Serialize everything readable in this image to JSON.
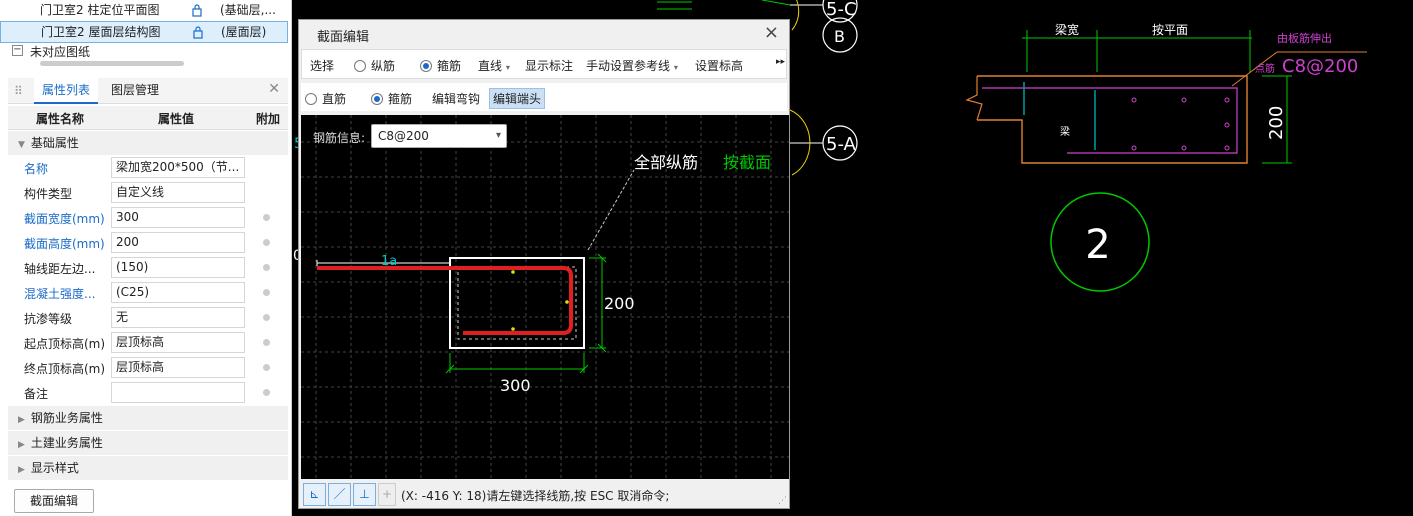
{
  "drawings": [
    {
      "name": "门卫室2 柱定位平面图",
      "layer": "(基础层,..."
    },
    {
      "name": "门卫室2 屋面层结构图",
      "layer": "(屋面层)"
    }
  ],
  "unmatched": "未对应图纸",
  "panel": {
    "tab_props": "属性列表",
    "tab_layers": "图层管理",
    "col_name": "属性名称",
    "col_value": "属性值",
    "col_extra": "附加",
    "group_basic": "基础属性",
    "rows": [
      {
        "key": "名称",
        "value": "梁加宽200*500（节..."
      },
      {
        "key": "构件类型",
        "value": "自定义线"
      },
      {
        "key": "截面宽度(mm)",
        "value": "300"
      },
      {
        "key": "截面高度(mm)",
        "value": "200"
      },
      {
        "key": "轴线距左边...",
        "value": "(150)"
      },
      {
        "key": "混凝土强度...",
        "value": "(C25)"
      },
      {
        "key": "抗渗等级",
        "value": "无"
      },
      {
        "key": "起点顶标高(m)",
        "value": "层顶标高"
      },
      {
        "key": "终点顶标高(m)",
        "value": "层顶标高"
      },
      {
        "key": "备注",
        "value": ""
      }
    ],
    "groups": [
      "钢筋业务属性",
      "土建业务属性",
      "显示样式"
    ],
    "bottom_button": "截面编辑"
  },
  "dialog": {
    "title": "截面编辑",
    "toolbar1": {
      "select": "选择",
      "longitudinal": "纵筋",
      "stirrup": "箍筋",
      "line": "直线",
      "show_label": "显示标注",
      "ref_line": "手动设置参考线",
      "set_elev": "设置标高",
      "more": "▸▸"
    },
    "toolbar2": {
      "straight": "直筋",
      "hoop": "箍筋",
      "edit_hook": "编辑弯钩",
      "edit_end": "编辑端头"
    },
    "rebar_label": "钢筋信息:",
    "rebar_value": "C8@200",
    "canvas": {
      "all_long": "全部纵筋",
      "by_section": "按截面",
      "la": "1a",
      "dim_h": "200",
      "dim_w": "300"
    },
    "status": "(X: -416 Y: 18)请左键选择线筋,按 ESC 取消命令;"
  },
  "cad": {
    "axis_c": "5-C",
    "axis_b": "B",
    "axis_a": "5-A",
    "axis_0": "0",
    "axis_5": "5",
    "detail_top1": "梁宽",
    "detail_top2": "按平面",
    "detail_note": "由板筋伸出",
    "detail_rebar": "C8@200",
    "detail_rebar_prefix": "点筋",
    "detail_dim": "200",
    "detail_side": "梁",
    "section_number": "2"
  },
  "colors": {
    "accent": "#1a6bc9",
    "cad_green": "#00c800",
    "rebar_red": "#e02020",
    "cad_magenta": "#d040d0",
    "cad_orange": "#e08030"
  }
}
